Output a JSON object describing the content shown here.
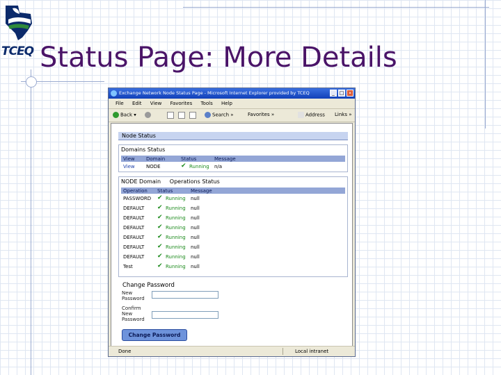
{
  "slide": {
    "title": "Status Page: More Details",
    "logo_text": "TCEQ"
  },
  "browser": {
    "window_title": "Exchange Network Node Status Page - Microsoft Internet Explorer provided by TCEQ",
    "menu": [
      "File",
      "Edit",
      "View",
      "Favorites",
      "Tools",
      "Help"
    ],
    "toolbar": {
      "back": "Back",
      "search": "Search",
      "favorites": "Favorites",
      "address": "Address",
      "links": "Links"
    },
    "status": {
      "done": "Done",
      "zone": "Local intranet"
    }
  },
  "page": {
    "node_status_header": "Node Status",
    "domains": {
      "title": "Domains Status",
      "columns": [
        "View",
        "Domain",
        "Status",
        "Message"
      ],
      "rows": [
        {
          "view": "View",
          "domain": "NODE",
          "status": "Running",
          "message": "n/a"
        }
      ]
    },
    "operations": {
      "title": "NODE Domain     Operations Status",
      "columns": [
        "Operation",
        "Status",
        "Message"
      ],
      "rows": [
        {
          "operation": "PASSWORD",
          "status": "Running",
          "message": "null"
        },
        {
          "operation": "DEFAULT",
          "status": "Running",
          "message": "null"
        },
        {
          "operation": "DEFAULT",
          "status": "Running",
          "message": "null"
        },
        {
          "operation": "DEFAULT",
          "status": "Running",
          "message": "null"
        },
        {
          "operation": "DEFAULT",
          "status": "Running",
          "message": "null"
        },
        {
          "operation": "DEFAULT",
          "status": "Running",
          "message": "null"
        },
        {
          "operation": "DEFAULT",
          "status": "Running",
          "message": "null"
        },
        {
          "operation": "Test",
          "status": "Running",
          "message": "null"
        }
      ]
    },
    "change_password": {
      "title": "Change Password",
      "new_label": "New Password",
      "confirm_label": "Confirm New Password",
      "new_value": "",
      "confirm_value": "",
      "button": "Change Password"
    }
  },
  "colors": {
    "title": "#4a1468",
    "running": "#1b8a1b",
    "table_header": "#93a6d6"
  }
}
